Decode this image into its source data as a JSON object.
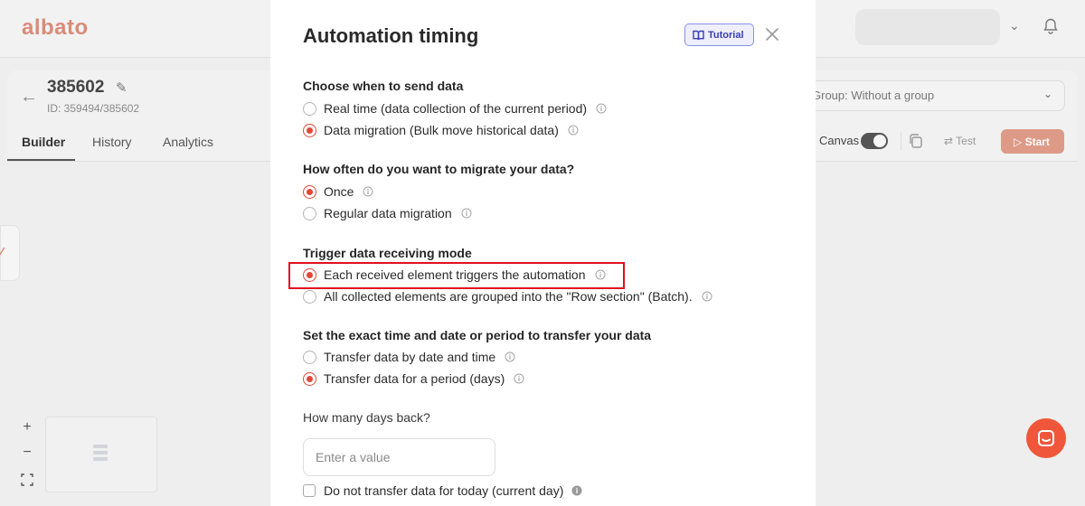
{
  "app": {
    "logo": "albato",
    "project": {
      "title": "385602",
      "id": "ID: 359494/385602"
    },
    "tabs": [
      {
        "label": "Builder",
        "active": true
      },
      {
        "label": "History",
        "active": false
      },
      {
        "label": "Analytics",
        "active": false
      }
    ],
    "group_select": "Group: Without a group",
    "canvas_label": "Canvas",
    "test_label": "Test",
    "start_label": "Start",
    "zoom_in": "+",
    "zoom_out": "−"
  },
  "modal": {
    "title": "Automation timing",
    "tutorial_label": "Tutorial",
    "sections": [
      {
        "title": "Choose when to send data",
        "options": [
          {
            "label": "Real time (data collection of the current period)",
            "checked": false
          },
          {
            "label": "Data migration (Bulk move historical data)",
            "checked": true
          }
        ]
      },
      {
        "title": "How often do you want to migrate your data?",
        "options": [
          {
            "label": "Once",
            "checked": true
          },
          {
            "label": "Regular data migration",
            "checked": false
          }
        ]
      },
      {
        "title": "Trigger data receiving mode",
        "options": [
          {
            "label": "Each received element triggers the automation",
            "checked": true
          },
          {
            "label": "All collected elements are grouped into the \"Row section\" (Batch).",
            "checked": false
          }
        ]
      },
      {
        "title": "Set the exact time and date or period to transfer your data",
        "options": [
          {
            "label": "Transfer data by date and time",
            "checked": false
          },
          {
            "label": "Transfer data for a period (days)",
            "checked": true
          }
        ]
      }
    ],
    "days_back": {
      "label": "How many days back?",
      "placeholder": "Enter a value",
      "value": ""
    },
    "exclude_today": {
      "label": "Do not transfer data for today (current day)",
      "checked": false
    }
  },
  "colors": {
    "accent": "#e0493a",
    "highlight": "#e0101e",
    "tutorial": "#3a3fb0",
    "chat": "#f0573a"
  },
  "icons": [
    "back-arrow-icon",
    "pencil-icon",
    "bell-icon",
    "chevron-down-icon",
    "copy-icon",
    "play-icon",
    "book-icon",
    "close-icon",
    "info-icon",
    "chat-icon",
    "fit-view-icon"
  ]
}
